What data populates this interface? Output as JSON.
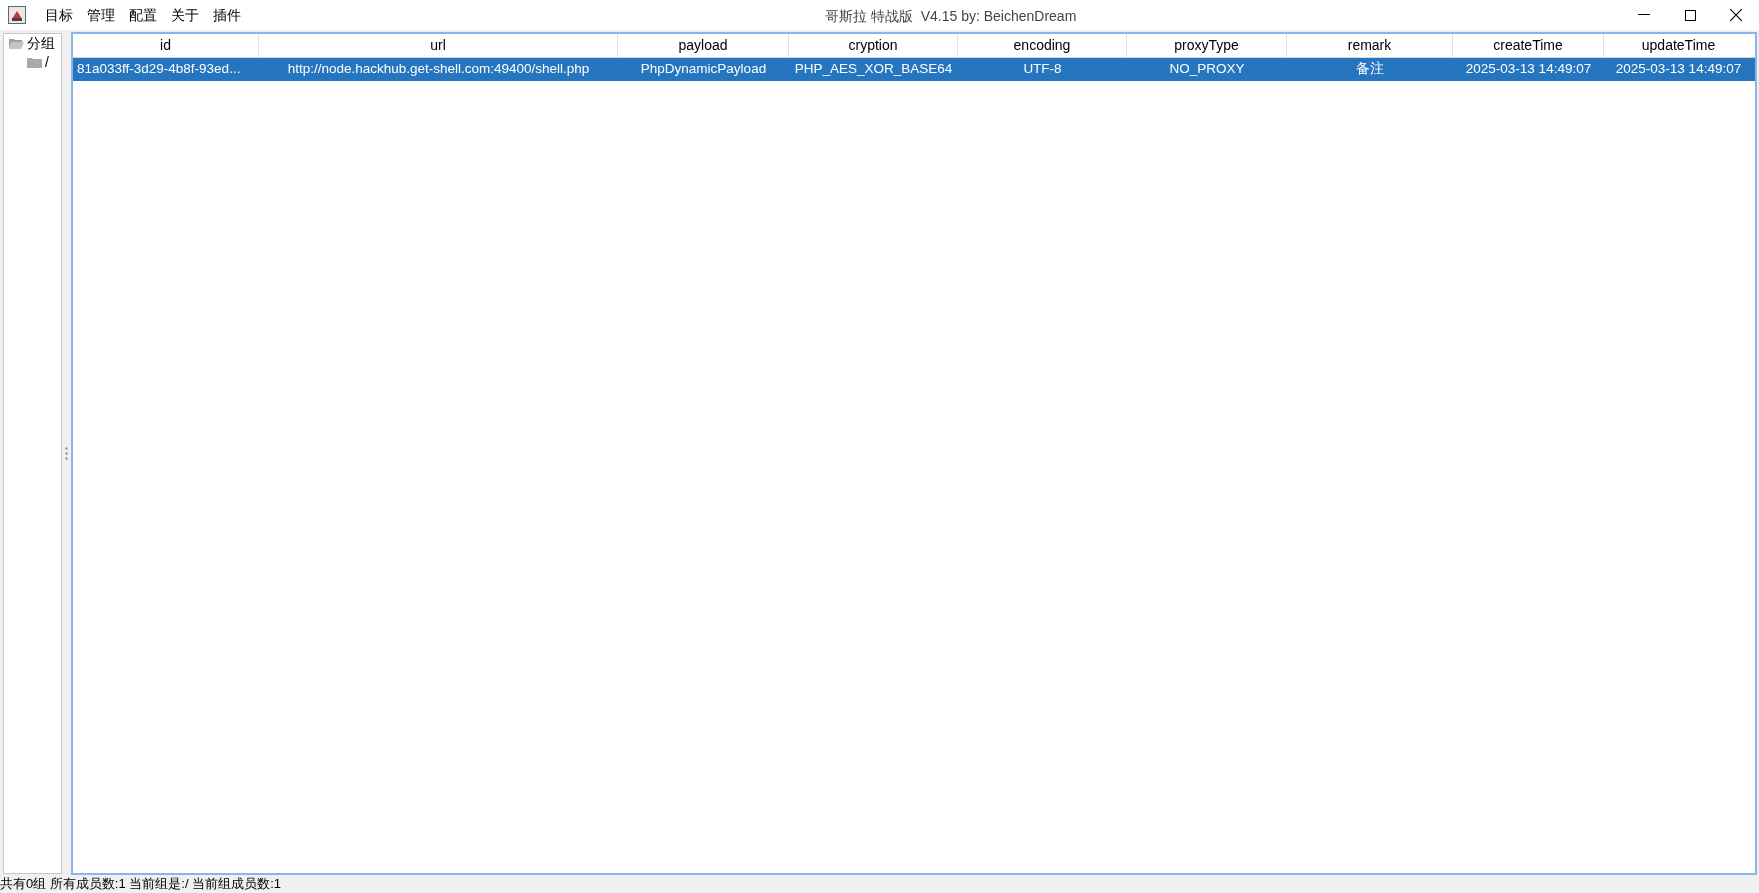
{
  "window": {
    "title": "哥斯拉 特战版  V4.15 by: BeichenDream"
  },
  "menu": [
    "目标",
    "管理",
    "配置",
    "关于",
    "插件"
  ],
  "tree": {
    "label": "分组",
    "expanded": true,
    "children": [
      {
        "label": "/",
        "expanded": false
      }
    ]
  },
  "table": {
    "columns": [
      "id",
      "url",
      "payload",
      "cryption",
      "encoding",
      "proxyType",
      "remark",
      "createTime",
      "updateTime"
    ],
    "rows": [
      {
        "selected": true,
        "cells": [
          "81a033ff-3d29-4b8f-93ed...",
          "http://node.hackhub.get-shell.com:49400/shell.php",
          "PhpDynamicPayload",
          "PHP_AES_XOR_BASE64",
          "UTF-8",
          "NO_PROXY",
          "备注",
          "2025-03-13 14:49:07",
          "2025-03-13 14:49:07"
        ]
      }
    ]
  },
  "status_bar": "共有0组 所有成员数:1 当前组是:/ 当前组成员数:1"
}
